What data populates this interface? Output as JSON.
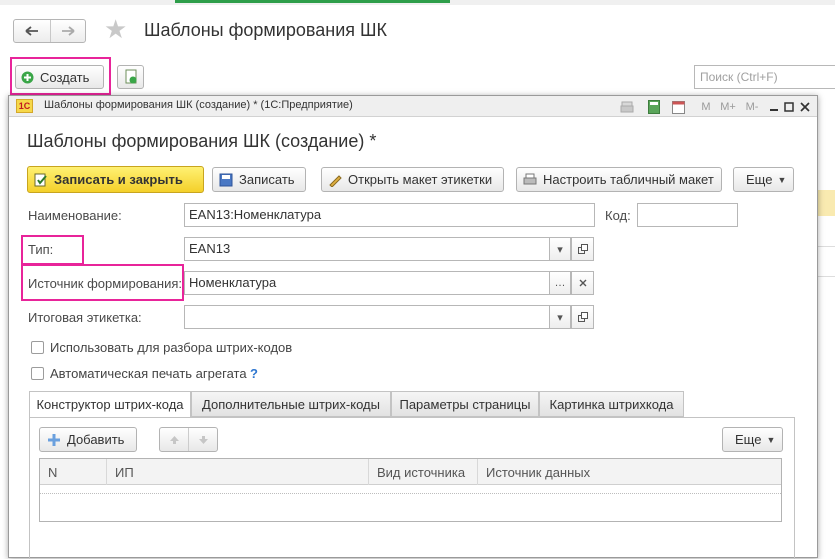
{
  "page": {
    "title": "Шаблоны формирования ШК",
    "create_label": "Создать",
    "search_placeholder": "Поиск (Ctrl+F)"
  },
  "window": {
    "title": "Шаблоны формирования ШК (создание) * (1С:Предприятие)",
    "logo": "1С",
    "toolbar_icons": [
      "print-icon",
      "calculator-icon",
      "calendar-icon"
    ],
    "memory_buttons": [
      "M",
      "M+",
      "M-"
    ]
  },
  "form": {
    "title": "Шаблоны формирования ШК (создание) *",
    "toolbar": {
      "save_close": "Записать и закрыть",
      "save": "Записать",
      "open_layout": "Открыть макет этикетки",
      "configure_layout": "Настроить табличный макет",
      "more": "Еще"
    },
    "fields": {
      "name_label": "Наименование:",
      "name_value": "EAN13:Номенклатура",
      "code_label": "Код:",
      "code_value": "",
      "type_label": "Тип:",
      "type_value": "EAN13",
      "source_label": "Источник формирования:",
      "source_value": "Номенклатура",
      "final_label_label": "Итоговая этикетка:",
      "final_label_value": ""
    },
    "checkboxes": {
      "use_for_parsing": "Использовать для разбора штрих-кодов",
      "auto_print": "Автоматическая печать агрегата",
      "help": "?"
    },
    "tabs": [
      "Конструктор штрих-кода",
      "Дополнительные штрих-коды",
      "Параметры страницы",
      "Картинка штрихкода"
    ],
    "panel": {
      "add_label": "Добавить",
      "more_label": "Еще",
      "columns": [
        "N",
        "ИП",
        "Вид источника",
        "Источник данных"
      ]
    }
  },
  "colors": {
    "highlight": "#e8249a",
    "primary_button": "#f4d02a",
    "accent_green": "#2e9e4a"
  }
}
